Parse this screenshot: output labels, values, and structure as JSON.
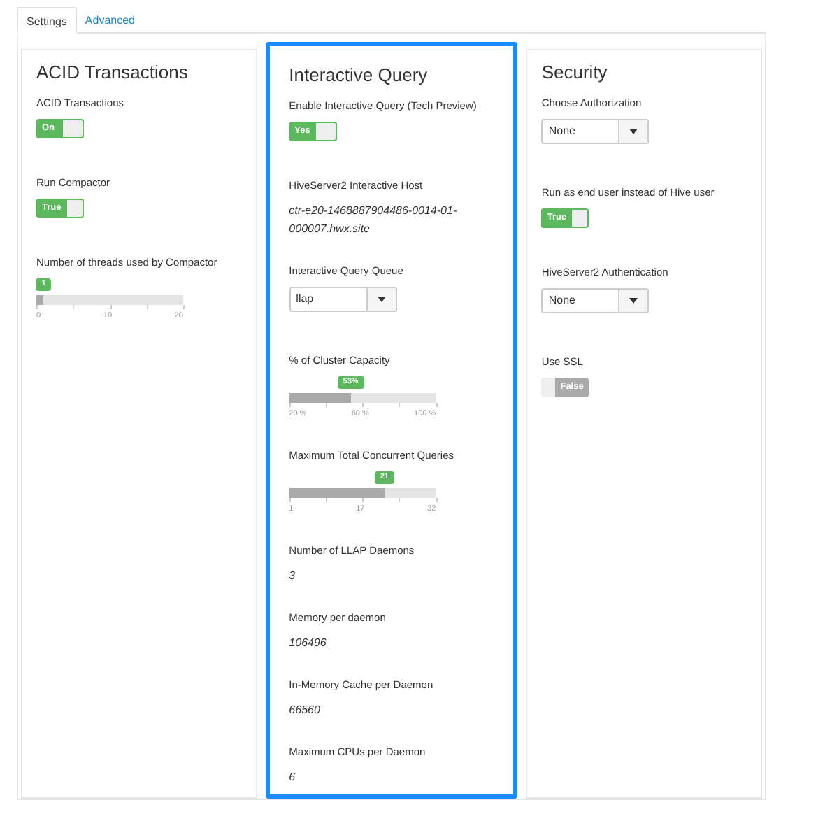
{
  "tabs": [
    {
      "label": "Settings",
      "selected": true
    },
    {
      "label": "Advanced",
      "selected": false
    }
  ],
  "panels": [
    {
      "title": "ACID Transactions",
      "highlighted": false,
      "items": [
        {
          "kind": "toggle",
          "label": "ACID Transactions",
          "value": "On",
          "on": true
        },
        {
          "kind": "toggle",
          "label": "Run Compactor",
          "value": "True",
          "on": true
        },
        {
          "kind": "slider",
          "label": "Number of threads used by Compactor",
          "bubble": "1",
          "level": 0.05,
          "ticks": [
            "0",
            "10",
            "20"
          ]
        }
      ]
    },
    {
      "title": "Interactive Query",
      "highlighted": true,
      "items": [
        {
          "kind": "toggle",
          "label": "Enable Interactive Query (Tech Preview)",
          "value": "Yes",
          "on": true
        },
        {
          "kind": "text",
          "label": "HiveServer2 Interactive Host",
          "value": "ctr-e20-1468887904486-0014-01-000007.hwx.site"
        },
        {
          "kind": "select",
          "label": "Interactive Query Queue",
          "value": "llap"
        },
        {
          "kind": "slider",
          "label": "% of Cluster Capacity",
          "bubble": "53%",
          "level": 0.42,
          "ticks": [
            "20 %",
            "60 %",
            "100 %"
          ]
        },
        {
          "kind": "slider",
          "label": "Maximum Total Concurrent Queries",
          "bubble": "21",
          "level": 0.65,
          "ticks": [
            "1",
            "17",
            "32"
          ]
        },
        {
          "kind": "text",
          "label": "Number of LLAP Daemons",
          "value": "3"
        },
        {
          "kind": "text",
          "label": "Memory per daemon",
          "value": "106496"
        },
        {
          "kind": "text",
          "label": "In-Memory Cache per Daemon",
          "value": "66560"
        },
        {
          "kind": "text",
          "label": "Maximum CPUs per Daemon",
          "value": "6"
        }
      ]
    },
    {
      "title": "Security",
      "highlighted": false,
      "items": [
        {
          "kind": "select",
          "label": "Choose Authorization",
          "value": "None"
        },
        {
          "kind": "toggle",
          "label": "Run as end user instead of Hive user",
          "value": "True",
          "on": true
        },
        {
          "kind": "select",
          "label": "HiveServer2 Authentication",
          "value": "None"
        },
        {
          "kind": "toggle",
          "label": "Use SSL",
          "value": "False",
          "on": false
        }
      ]
    }
  ]
}
